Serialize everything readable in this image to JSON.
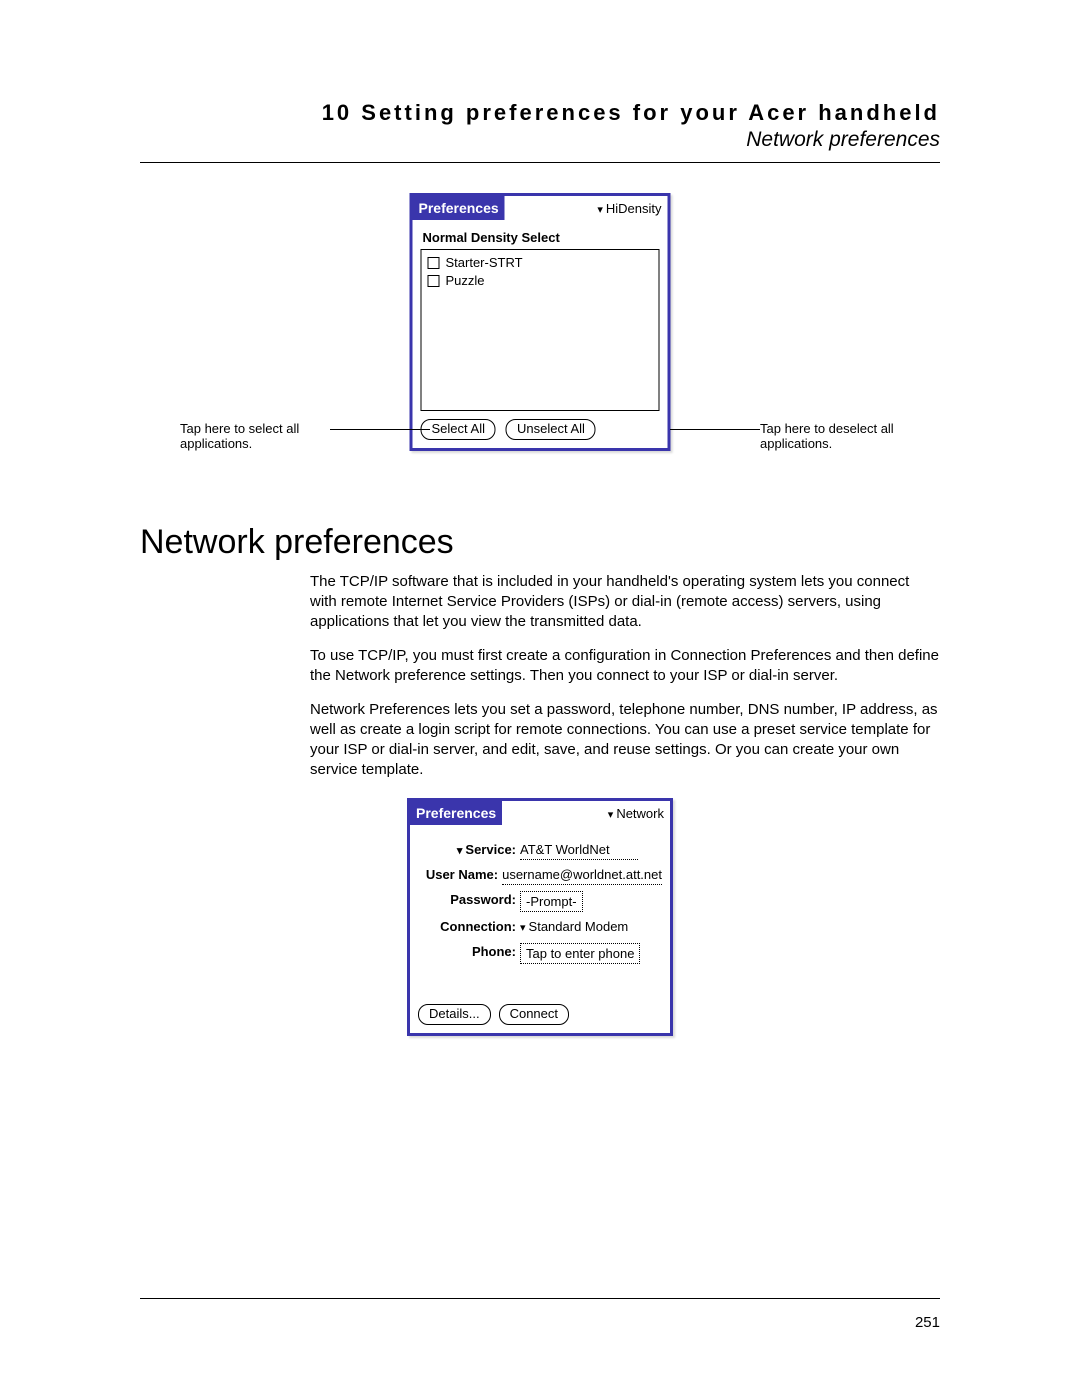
{
  "header": {
    "chapter": "10 Setting preferences for your Acer handheld",
    "section": "Network preferences"
  },
  "fig1": {
    "title": "Preferences",
    "dropdown": "HiDensity",
    "listLabel": "Normal Density Select",
    "items": [
      "Starter-STRT",
      "Puzzle"
    ],
    "selectAll": "Select All",
    "unselectAll": "Unselect All",
    "calloutLeft": "Tap here to select all applications.",
    "calloutRight": "Tap here to deselect all applications."
  },
  "section": {
    "heading": "Network preferences",
    "p1": "The TCP/IP software that is included in your handheld's operating system lets you connect with remote Internet Service Providers (ISPs) or dial-in (remote access) servers, using applications that let you view the transmitted data.",
    "p2": "To use TCP/IP, you must first create a configuration in Connection Preferences and then define the Network preference settings. Then you connect to your ISP or dial-in server.",
    "p3": "Network Preferences lets you set a password, telephone number, DNS number, IP address, as well as create a login script for remote connections. You can use a preset service template for your ISP or dial-in server, and edit, save, and reuse settings. Or you can create your own service template."
  },
  "fig2": {
    "title": "Preferences",
    "dropdown": "Network",
    "serviceLabel": "Service:",
    "serviceValue": "AT&T WorldNet",
    "userLabel": "User Name:",
    "userValue": "username@worldnet.att.net",
    "passwordLabel": "Password:",
    "passwordValue": "-Prompt-",
    "connectionLabel": "Connection:",
    "connectionValue": "Standard Modem",
    "phoneLabel": "Phone:",
    "phoneValue": "Tap to enter phone",
    "details": "Details...",
    "connect": "Connect"
  },
  "pageNumber": "251"
}
